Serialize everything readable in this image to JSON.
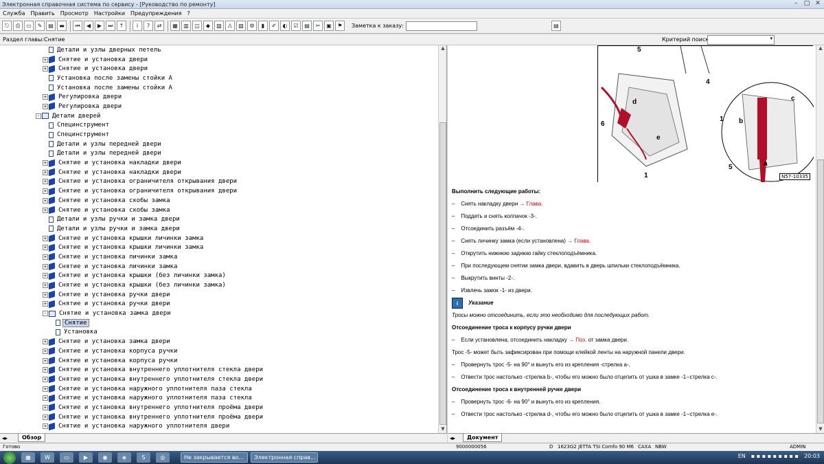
{
  "window": {
    "title": "Электронная справочная система по сервису - [Руководство по ремонту]"
  },
  "menu": [
    "Служба",
    "Править",
    "Просмотр",
    "Настройки",
    "Предупреждения",
    "?"
  ],
  "toolbar": {
    "note_label": "Заметка к заказу:",
    "note_value": ""
  },
  "section": {
    "label": "Раздел главы:Снятие",
    "criteria_label": "Критерий  поиска:",
    "criteria_value": ""
  },
  "tree": [
    {
      "indent": 6,
      "type": "doc",
      "label": "Детали и узлы дверных петель"
    },
    {
      "indent": 6,
      "type": "book",
      "exp": "+",
      "label": "Снятие и установка двери"
    },
    {
      "indent": 6,
      "type": "book",
      "exp": "+",
      "label": "Снятие и установка двери"
    },
    {
      "indent": 6,
      "type": "doc",
      "label": "Установка после замены стойки А"
    },
    {
      "indent": 6,
      "type": "doc",
      "label": "Установка после замены стойки А"
    },
    {
      "indent": 6,
      "type": "book",
      "exp": "+",
      "label": "Регулировка двери"
    },
    {
      "indent": 6,
      "type": "book",
      "exp": "+",
      "label": "Регулировка двери"
    },
    {
      "indent": 5,
      "type": "open",
      "exp": "-",
      "label": "Детали дверей"
    },
    {
      "indent": 6,
      "type": "doc",
      "label": "Специнструмент"
    },
    {
      "indent": 6,
      "type": "doc",
      "label": "Специнструмент"
    },
    {
      "indent": 6,
      "type": "doc",
      "label": "Детали и узлы передней двери"
    },
    {
      "indent": 6,
      "type": "doc",
      "label": "Детали и узлы передней двери"
    },
    {
      "indent": 6,
      "type": "book",
      "exp": "+",
      "label": "Снятие и установка накладки двери"
    },
    {
      "indent": 6,
      "type": "book",
      "exp": "+",
      "label": "Снятие и установка накладки двери"
    },
    {
      "indent": 6,
      "type": "book",
      "exp": "+",
      "label": "Снятие и установка ограничителя открывания двери"
    },
    {
      "indent": 6,
      "type": "book",
      "exp": "+",
      "label": "Снятие и установка ограничителя открывания двери"
    },
    {
      "indent": 6,
      "type": "book",
      "exp": "+",
      "label": "Снятие и установка скобы замка"
    },
    {
      "indent": 6,
      "type": "book",
      "exp": "+",
      "label": "Снятие и установка скобы замка"
    },
    {
      "indent": 6,
      "type": "doc",
      "label": "Детали и узлы ручки и замка двери"
    },
    {
      "indent": 6,
      "type": "doc",
      "label": "Детали и узлы ручки и замка двери"
    },
    {
      "indent": 6,
      "type": "book",
      "exp": "+",
      "label": "Снятие и установка крышки личинки замка"
    },
    {
      "indent": 6,
      "type": "book",
      "exp": "+",
      "label": "Снятие и установка крышки личинки замка"
    },
    {
      "indent": 6,
      "type": "book",
      "exp": "+",
      "label": "Снятие и установка личинки замка"
    },
    {
      "indent": 6,
      "type": "book",
      "exp": "+",
      "label": "Снятие и установка личинки замка"
    },
    {
      "indent": 6,
      "type": "book",
      "exp": "+",
      "label": "Снятие и установка крышки (без личинки замка)"
    },
    {
      "indent": 6,
      "type": "book",
      "exp": "+",
      "label": "Снятие и установка крышки (без личинки замка)"
    },
    {
      "indent": 6,
      "type": "book",
      "exp": "+",
      "label": "Снятие и установка ручки двери"
    },
    {
      "indent": 6,
      "type": "book",
      "exp": "+",
      "label": "Снятие и установка ручки двери"
    },
    {
      "indent": 6,
      "type": "open",
      "exp": "-",
      "label": "Снятие и установка замка двери"
    },
    {
      "indent": 7,
      "type": "doc",
      "label": "Снятие",
      "selected": true
    },
    {
      "indent": 7,
      "type": "doc",
      "label": "Установка"
    },
    {
      "indent": 6,
      "type": "book",
      "exp": "+",
      "label": "Снятие и установка замка двери"
    },
    {
      "indent": 6,
      "type": "book",
      "exp": "+",
      "label": "Снятие и установка корпуса ручки"
    },
    {
      "indent": 6,
      "type": "book",
      "exp": "+",
      "label": "Снятие и установка корпуса ручки"
    },
    {
      "indent": 6,
      "type": "book",
      "exp": "+",
      "label": "Снятие и установка внутреннего уплотнителя стекла двери"
    },
    {
      "indent": 6,
      "type": "book",
      "exp": "+",
      "label": "Снятие и установка внутреннего уплотнителя стекла двери"
    },
    {
      "indent": 6,
      "type": "book",
      "exp": "+",
      "label": "Снятие и установка наружного уплотнителя паза стекла"
    },
    {
      "indent": 6,
      "type": "book",
      "exp": "+",
      "label": "Снятие и установка наружного уплотнителя паза стекла"
    },
    {
      "indent": 6,
      "type": "book",
      "exp": "+",
      "label": "Снятие и установка внутреннего уплотнителя проёма двери"
    },
    {
      "indent": 6,
      "type": "book",
      "exp": "+",
      "label": "Снятие и установка внутреннего уплотнителя проёма двери"
    },
    {
      "indent": 6,
      "type": "book",
      "exp": "+",
      "label": "Снятие и установка наружного уплотнителя двери"
    }
  ],
  "left_tab": "Обзор",
  "right_tab": "Документ",
  "figure": {
    "callouts": [
      "5",
      "4",
      "6",
      "d",
      "e",
      "1",
      "1",
      "b",
      "c",
      "5",
      "a"
    ],
    "code": "N57-10335"
  },
  "doc": {
    "heading1": "Выполнить следующие работы:",
    "steps1": [
      {
        "text": "Снять накладку двери ",
        "link": "→ Глава."
      },
      {
        "text": "Поддеть и снять колпачок -3-.",
        "link": ""
      },
      {
        "text": "Отсоединить разъём -4-.",
        "link": ""
      },
      {
        "text": "Снять личинку замка (если установлена) ",
        "link": "→ Глава."
      },
      {
        "text": "Открутить нижнюю заднюю гайку стеклоподъёмника.",
        "link": ""
      },
      {
        "text": "При последующем снятии замка двери, вдавить в дверь шпильки стеклоподъёмника.",
        "link": ""
      },
      {
        "text": "Выкрутить винты -2-.",
        "link": ""
      },
      {
        "text": "Извлечь замок -1- из двери.",
        "link": ""
      }
    ],
    "hint_title": "Указание",
    "hint_text": "Тросы можно отсоединить, если это необходимо для последующих работ.",
    "heading2": "Отсоединение троса к корпусу ручки двери",
    "step2a_pre": "Если установлена, отсоединить накладку ",
    "step2a_link": "→ Поз.",
    "step2a_post": " от замка двери.",
    "note2": "Трос -5- может быть зафиксирован при помощи клейкой ленты на наружной панели двери.",
    "step2b": "Провернуть трос -5- на 90° и вынуть его из крепления -стрелка а-.",
    "step2c": "Отвести трос настолько -стрелка b-, чтобы его можно было отцепить от ушка в замке -1--стрелка с-.",
    "heading3": "Отсоединение троса к внутренней ручке двери",
    "step3a": "Провернуть трос -6- на 90° и вынуть его из крепления.",
    "step3b": "Отвести трос настолько -стрелка d-, чтобы его можно было отцепить от ушка в замке -1--стрелка е-."
  },
  "status": {
    "ready": "Готово",
    "order": "9000000056",
    "d": "D",
    "code": "1623G2",
    "vehicle": "JETTA TSI Comfo 90 M6",
    "caxa": "CAXA",
    "nbw": "NBW",
    "user": "ADMIN"
  },
  "taskbar": {
    "task1": "Не закрывается во...",
    "task2": "Электронная справ...",
    "lang": "EN",
    "time": "20:03"
  }
}
